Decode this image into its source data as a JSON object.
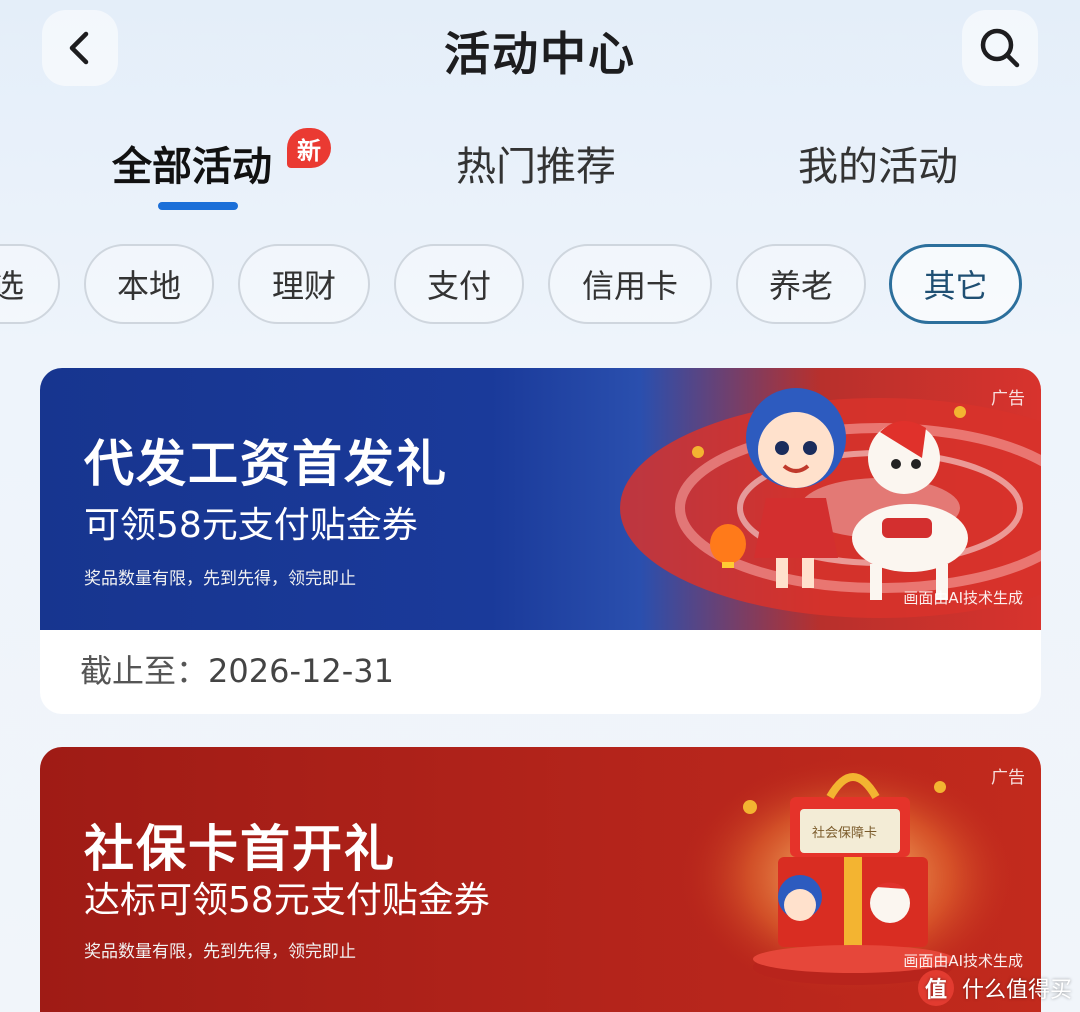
{
  "header": {
    "title": "活动中心",
    "back_icon": "chevron-left-icon",
    "search_icon": "search-icon"
  },
  "tabs": [
    {
      "label": "全部活动",
      "badge": "新",
      "active": true
    },
    {
      "label": "热门推荐",
      "active": false
    },
    {
      "label": "我的活动",
      "active": false
    }
  ],
  "chips": [
    {
      "label": "选",
      "active": false
    },
    {
      "label": "本地",
      "active": false
    },
    {
      "label": "理财",
      "active": false
    },
    {
      "label": "支付",
      "active": false
    },
    {
      "label": "信用卡",
      "active": false
    },
    {
      "label": "养老",
      "active": false
    },
    {
      "label": "其它",
      "active": true
    }
  ],
  "cards": [
    {
      "title": "代发工资首发礼",
      "subtitle": "可领58元支付贴金券",
      "note": "奖品数量有限，先到先得，领完即止",
      "ad_tag": "广告",
      "ai_tag": "画面由AI技术生成",
      "deadline_label": "截止至：",
      "deadline_value": "2026-12-31"
    },
    {
      "title": "社保卡首开礼",
      "subtitle": "达标可领58元支付贴金券",
      "note": "奖品数量有限，先到先得，领完即止",
      "ad_tag": "广告",
      "ai_tag": "画面由AI技术生成",
      "illustration_text": "社会保障卡"
    }
  ],
  "watermark": {
    "logo": "值",
    "text": "什么值得买"
  },
  "colors": {
    "accent_blue": "#1b6fd8",
    "badge_red": "#ea3a32",
    "chip_active_border": "#2c6f9c",
    "banner_blue": "#17358f",
    "banner_red": "#b3241b"
  }
}
